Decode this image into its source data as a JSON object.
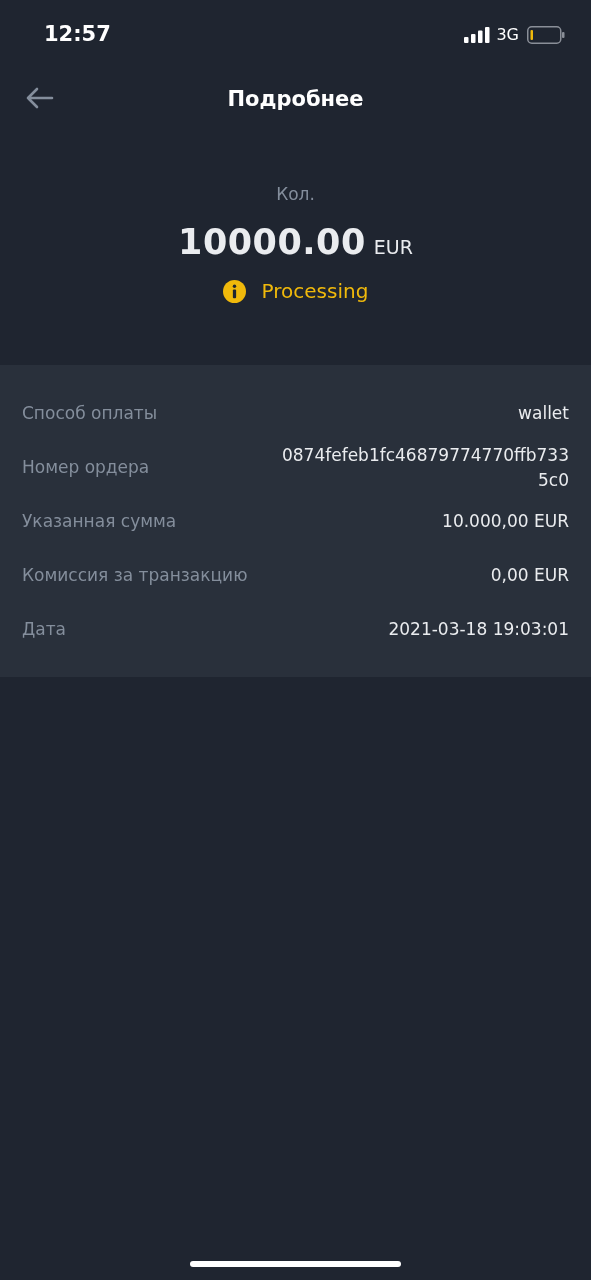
{
  "status_bar": {
    "time": "12:57",
    "network": "3G"
  },
  "header": {
    "title": "Подробнее"
  },
  "summary": {
    "label": "Кол.",
    "amount": "10000.00",
    "currency": "EUR",
    "status": {
      "kind": "processing",
      "text": "Processing"
    }
  },
  "details": [
    {
      "label": "Способ оплаты",
      "value": "wallet"
    },
    {
      "label": "Номер ордера",
      "value": "0874fefeb1fc46879774770ffb7335c0"
    },
    {
      "label": "Указанная сумма",
      "value": "10.000,00 EUR"
    },
    {
      "label": "Комиссия за транзакцию",
      "value": "0,00 EUR"
    },
    {
      "label": "Дата",
      "value": "2021-03-18 19:03:01"
    }
  ]
}
